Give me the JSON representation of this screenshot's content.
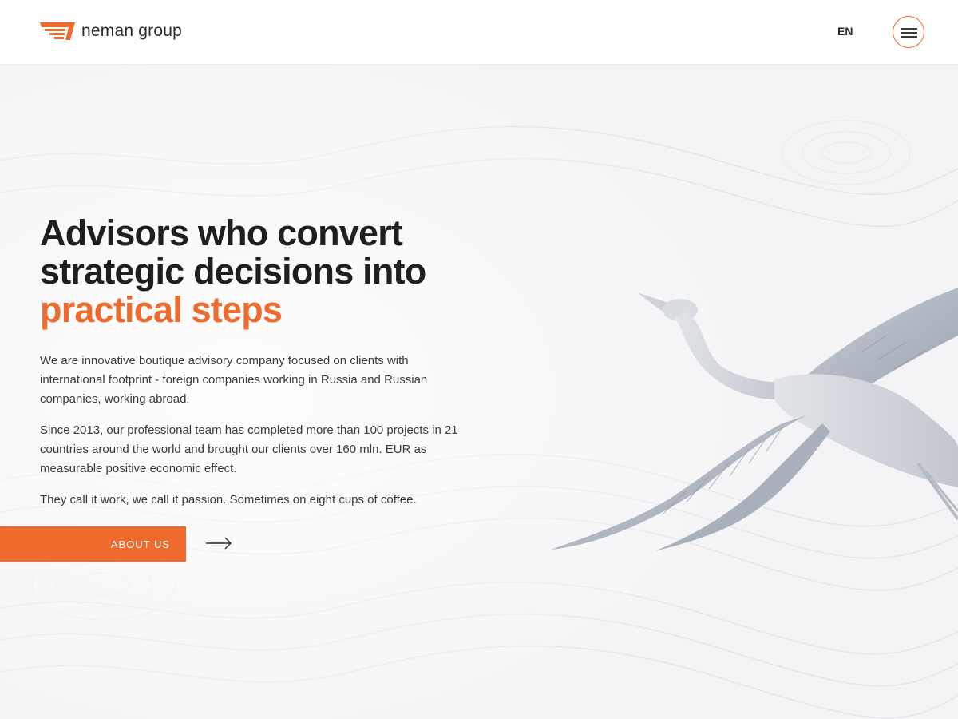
{
  "header": {
    "logo_text": "neman group",
    "language": "EN",
    "menu_icon": "hamburger-icon"
  },
  "hero": {
    "headline_line1": "Advisors who convert",
    "headline_line2": "strategic decisions into",
    "headline_accent": "practical steps",
    "paragraph1": "We are innovative boutique advisory company focused on clients with international footprint - foreign companies working in Russia and Russian companies, working abroad.",
    "paragraph2": "Since 2013, our professional team has completed more than 100 projects in 21 countries around the world and brought our clients over 160 mln. EUR as measurable positive economic effect.",
    "paragraph3": "They call it work, we call it passion. Sometimes on eight cups of coffee.",
    "cta_label": "ABOUT US",
    "cta_icon": "arrow-right-icon"
  },
  "colors": {
    "accent": "#ee6a2d",
    "text": "#1f1f1f",
    "background": "#f7f7f8"
  },
  "illustration": "flying-crane-image"
}
